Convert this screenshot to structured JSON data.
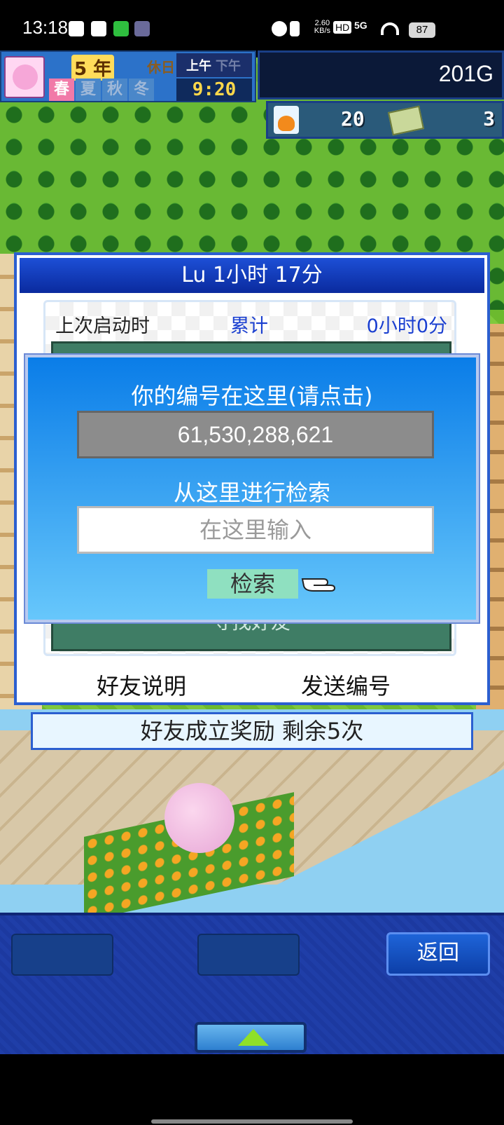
{
  "status_bar": {
    "time": "13:18",
    "net_speed_value": "2.60",
    "net_speed_unit": "KB/s",
    "hd_label": "HD",
    "network": "5G",
    "battery": "87"
  },
  "hud": {
    "year_number": "5",
    "year_unit": "年",
    "holiday_label": "休日",
    "am_label": "上午",
    "pm_label": "下午",
    "seasons": [
      "春",
      "夏",
      "秋",
      "冬"
    ],
    "active_season": "春",
    "clock": "9:20",
    "money": "201G",
    "research_points": "20",
    "ticket_count": "3"
  },
  "friend_panel": {
    "title": "Lu  1小时 17分",
    "last_launch_label": "上次启动时",
    "total_label": "累计",
    "total_value": "0小时0分",
    "find_friend_label": "寻找好友",
    "friend_help_button": "好友说明",
    "send_id_button": "发送编号"
  },
  "search_dialog": {
    "title": "你的编号在这里(请点击)",
    "player_id": "61,530,288,621",
    "search_title": "从这里进行检索",
    "input_placeholder": "在这里输入",
    "search_button": "检索"
  },
  "bonus_bar": {
    "text": "好友成立奖励  剩余5次"
  },
  "bottom_bar": {
    "back_button": "返回"
  }
}
